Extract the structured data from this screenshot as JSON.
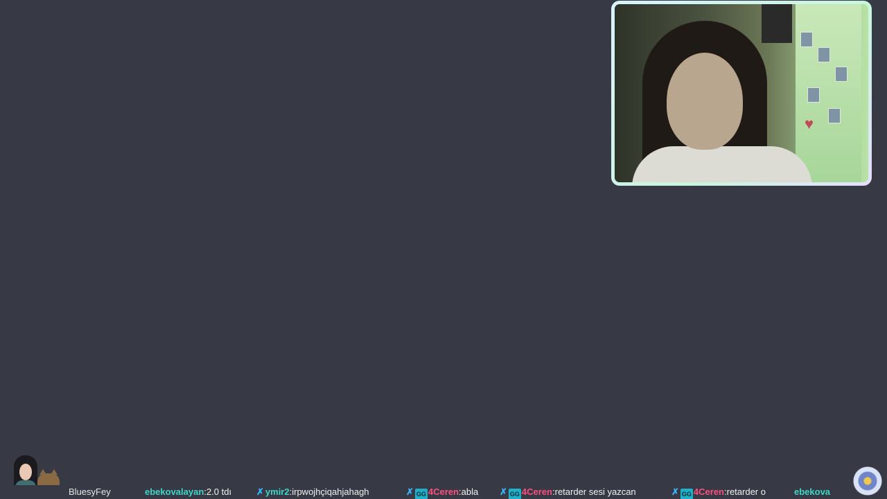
{
  "stream": {
    "channel_name": "BluesyFey",
    "background_color": "#373a44",
    "webcam": {
      "border_color": "#c8f5dc",
      "description_icon": "webcam-feed"
    },
    "chat_ticker": [
      {
        "user": "ebekovalayan",
        "user_suffix": ":",
        "text": "2.0 tdı",
        "user_color": "#3fd6c8",
        "badges": []
      },
      {
        "user": "ymir2",
        "user_suffix": ":",
        "text": "irpwojhçiqahjahagh",
        "user_color": "#3fd6c8",
        "badges": [
          "sword-badge"
        ]
      },
      {
        "user": "4Ceren",
        "user_suffix": ":",
        "text": "abla",
        "user_color": "#ff4f7e",
        "badges": [
          "sword-badge",
          "square-badge"
        ]
      },
      {
        "user": "4Ceren",
        "user_suffix": ":",
        "text": "retarder sesi yazcan",
        "user_color": "#ff4f7e",
        "badges": [
          "sword-badge",
          "square-badge"
        ]
      },
      {
        "user": "4Ceren",
        "user_suffix": ":",
        "text": "retarder o",
        "user_color": "#ff4f7e",
        "badges": [
          "sword-badge",
          "square-badge"
        ]
      },
      {
        "user": "ebekova",
        "user_suffix": "",
        "text": "",
        "user_color": "#3fd6c8",
        "badges": []
      }
    ],
    "badge_square_text": "GG"
  }
}
